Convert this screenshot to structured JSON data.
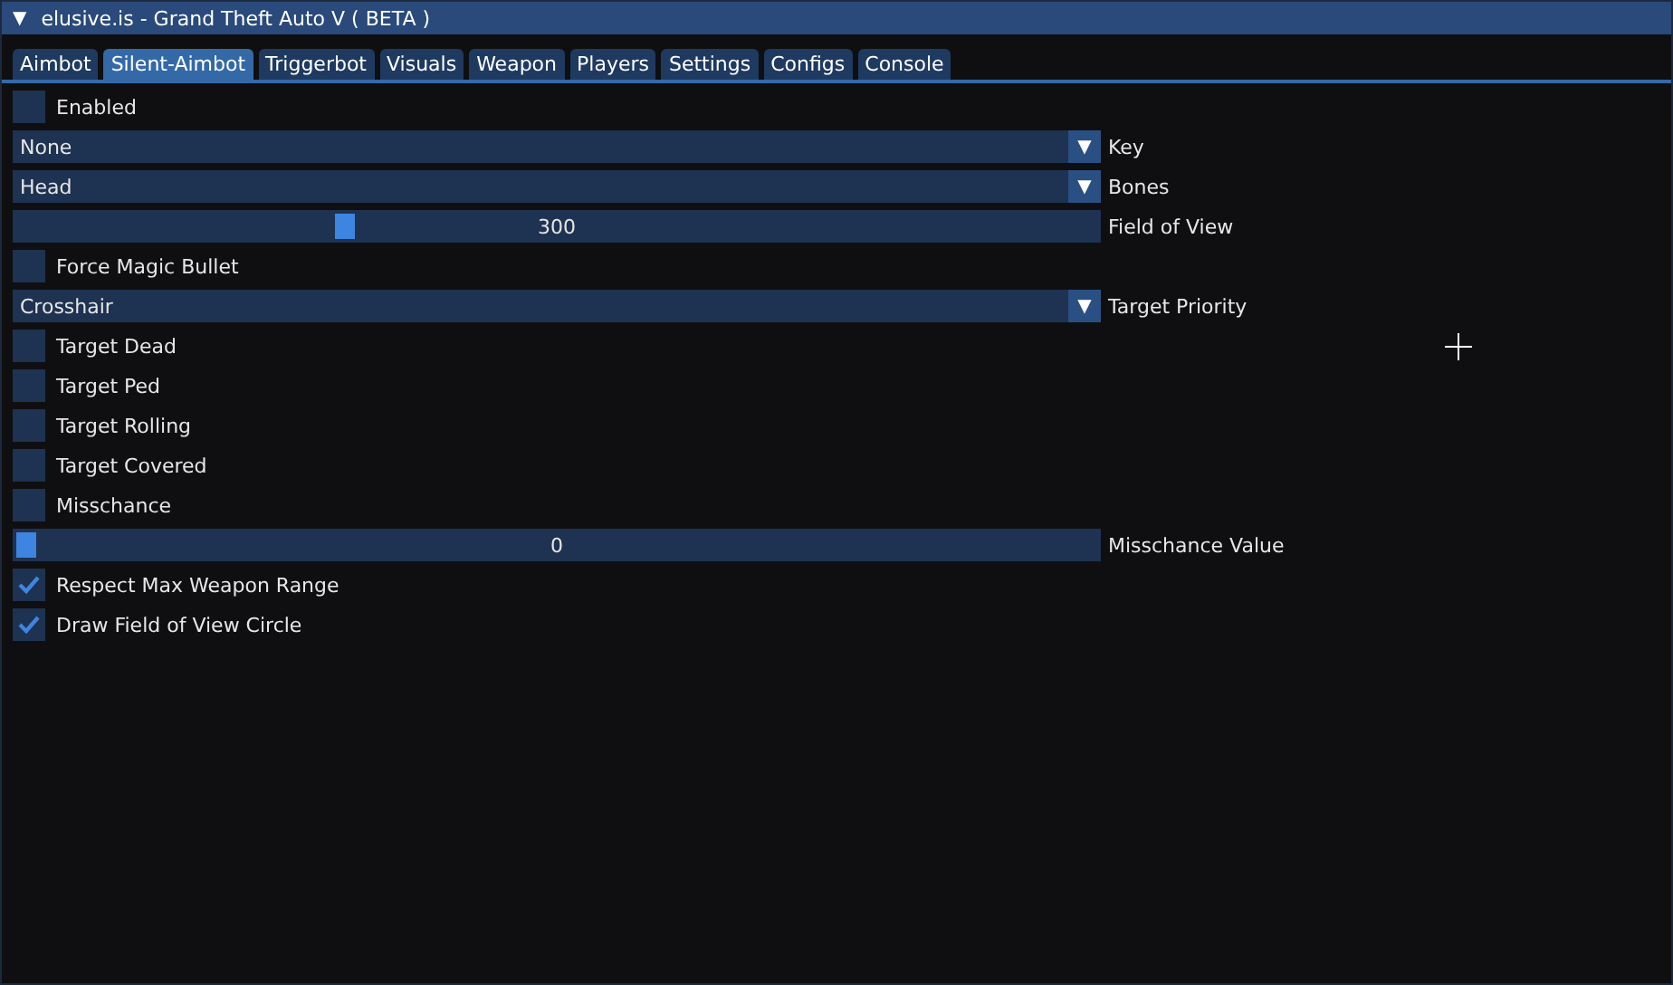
{
  "window": {
    "title": "elusive.is - Grand Theft Auto V ( BETA )",
    "collapse_arrow": "▼"
  },
  "tabs": [
    {
      "label": "Aimbot",
      "selected": false
    },
    {
      "label": "Silent-Aimbot",
      "selected": true
    },
    {
      "label": "Triggerbot",
      "selected": false
    },
    {
      "label": "Visuals",
      "selected": false
    },
    {
      "label": "Weapon",
      "selected": false
    },
    {
      "label": "Players",
      "selected": false
    },
    {
      "label": "Settings",
      "selected": false
    },
    {
      "label": "Configs",
      "selected": false
    },
    {
      "label": "Console",
      "selected": false
    }
  ],
  "controls": [
    {
      "kind": "checkbox",
      "label": "Enabled",
      "checked": false
    },
    {
      "kind": "combo",
      "label": "Key",
      "selection": "None",
      "arrow": "▼"
    },
    {
      "kind": "combo",
      "label": "Bones",
      "selection": "Head",
      "arrow": "▼"
    },
    {
      "kind": "slider",
      "value": "300",
      "level": 0.3,
      "label": "Field of View"
    },
    {
      "kind": "checkbox",
      "label": "Force Magic Bullet",
      "checked": false
    },
    {
      "kind": "combo",
      "label": "Target Priority",
      "selection": "Crosshair",
      "arrow": "▼"
    },
    {
      "kind": "checkbox",
      "label": "Target Dead",
      "checked": false
    },
    {
      "kind": "checkbox",
      "label": "Target Ped",
      "checked": false
    },
    {
      "kind": "checkbox",
      "label": "Target Rolling",
      "checked": false
    },
    {
      "kind": "checkbox",
      "label": "Target Covered",
      "checked": false
    },
    {
      "kind": "checkbox",
      "label": "Misschance",
      "checked": false
    },
    {
      "kind": "slider",
      "value": "0",
      "level": 0,
      "label": "Misschance Value"
    },
    {
      "kind": "checkbox",
      "label": "Respect Max Weapon Range",
      "checked": true
    },
    {
      "kind": "checkbox",
      "label": "Draw Field of View Circle",
      "checked": true
    }
  ]
}
